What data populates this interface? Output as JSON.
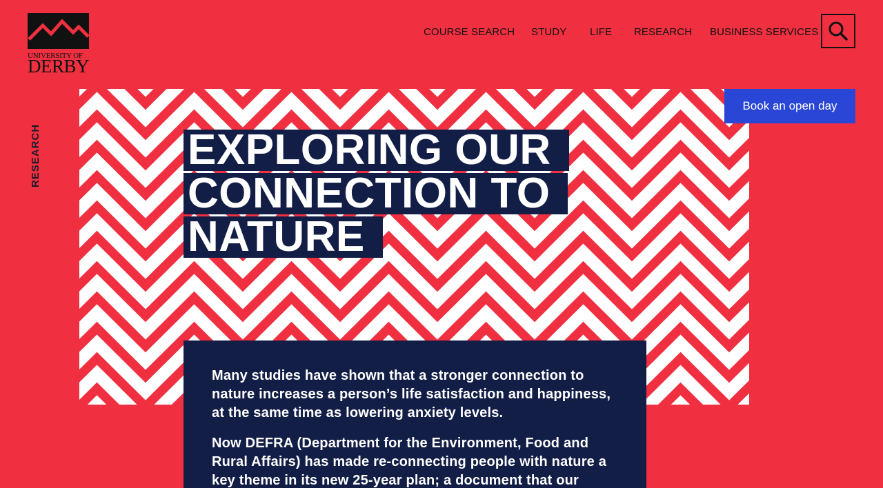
{
  "logo": {
    "line1": "UNIVERSITY OF",
    "line2": "DERBY"
  },
  "nav": {
    "items": [
      {
        "label": "COURSE SEARCH"
      },
      {
        "label": "STUDY"
      },
      {
        "label": "LIFE"
      },
      {
        "label": "RESEARCH"
      },
      {
        "label": "BUSINESS SERVICES"
      }
    ],
    "search_icon": "search-icon"
  },
  "side_label": "RESEARCH",
  "cta": {
    "open_day": "Book an open day"
  },
  "hero": {
    "title_lines": [
      "EXPLORING OUR",
      "CONNECTION TO",
      "NATURE"
    ]
  },
  "article": {
    "paragraphs": [
      "Many studies have shown that a stronger connection to nature increases a person’s life satisfaction and happiness, at the same time as lowering anxiety levels.",
      "Now DEFRA (Department for the Environment, Food and Rural Affairs) has made re-connecting people with nature a key theme in its new 25-year plan; a document that our"
    ]
  },
  "colors": {
    "background": "#f03040",
    "navy": "#131e47",
    "button_blue": "#2a46d6",
    "stripe_white": "#ffffff"
  }
}
